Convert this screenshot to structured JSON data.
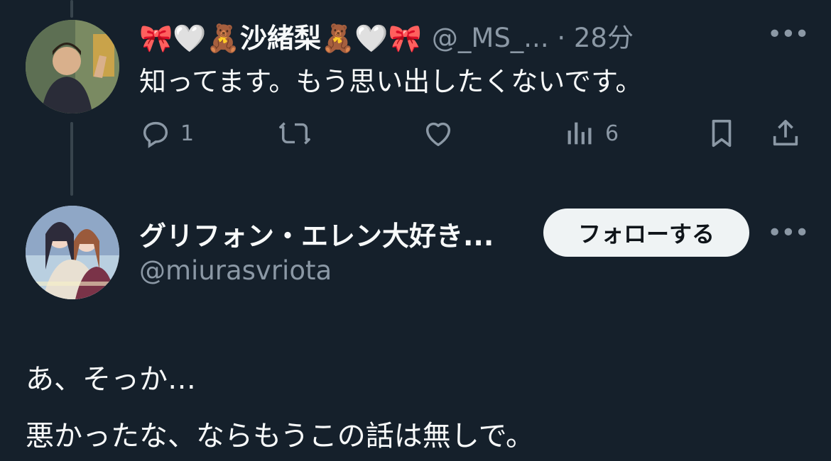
{
  "reply_tweet": {
    "display_name": "🎀🤍🧸沙緒梨🧸🤍🎀",
    "handle": "@_MS_...",
    "separator": "·",
    "time": "28分",
    "more": "•••",
    "text": "知ってます。もう思い出したくないです。",
    "actions": {
      "reply_count": "1",
      "views_count": "6",
      "icons": [
        "reply-icon",
        "retweet-icon",
        "like-icon",
        "views-icon",
        "bookmark-icon",
        "share-icon"
      ]
    }
  },
  "main_tweet": {
    "display_name": "グリフォン・エレン大好き...",
    "handle": "@miurasvriota",
    "follow_label": "フォローする",
    "more": "•••",
    "lines": [
      "あ、そっか…",
      "悪かったな、ならもうこの話は無しで。"
    ]
  },
  "colors": {
    "background": "#15202b",
    "text": "#f7f9f9",
    "secondary": "#8b98a5",
    "thread_line": "#38444d",
    "follow_bg": "#eff3f4"
  }
}
